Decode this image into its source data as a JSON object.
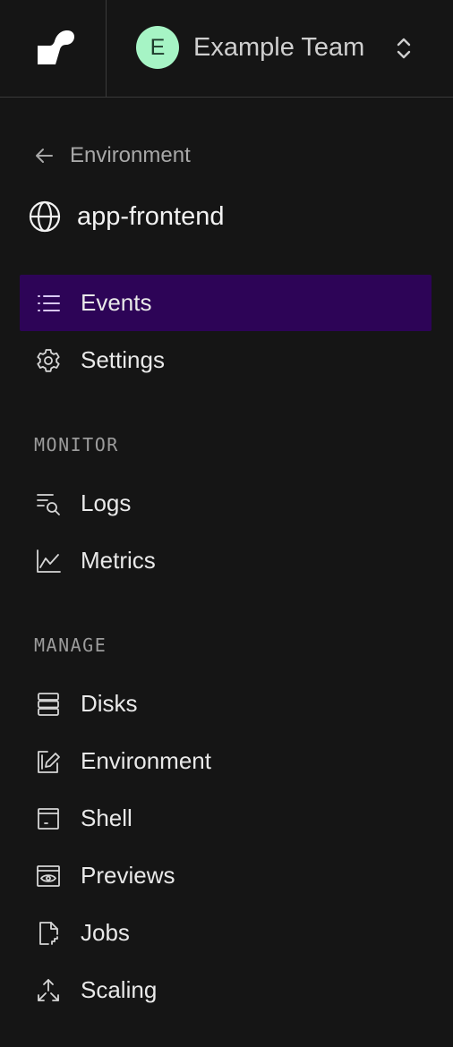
{
  "topbar": {
    "logo_icon": "brand-logo-icon",
    "team": {
      "avatar_letter": "E",
      "name": "Example Team",
      "switch_icon": "chevron-up-down-icon",
      "avatar_color": "#a6f4c5"
    }
  },
  "back_link": {
    "icon": "arrow-left-icon",
    "label": "Environment"
  },
  "service": {
    "icon": "globe-icon",
    "name": "app-frontend"
  },
  "nav": {
    "primary": [
      {
        "label": "Events",
        "icon": "list-icon",
        "active": true
      },
      {
        "label": "Settings",
        "icon": "gear-icon",
        "active": false
      }
    ],
    "monitor": {
      "heading": "MONITOR",
      "items": [
        {
          "label": "Logs",
          "icon": "log-search-icon"
        },
        {
          "label": "Metrics",
          "icon": "line-chart-icon"
        }
      ]
    },
    "manage": {
      "heading": "MANAGE",
      "items": [
        {
          "label": "Disks",
          "icon": "disk-stack-icon"
        },
        {
          "label": "Environment",
          "icon": "edit-document-icon"
        },
        {
          "label": "Shell",
          "icon": "terminal-window-icon"
        },
        {
          "label": "Previews",
          "icon": "preview-eye-icon"
        },
        {
          "label": "Jobs",
          "icon": "file-job-icon"
        },
        {
          "label": "Scaling",
          "icon": "scale-arrows-icon"
        }
      ]
    }
  },
  "colors": {
    "background": "#151515",
    "active_item": "#2d0457",
    "divider": "#3a3a3a"
  }
}
